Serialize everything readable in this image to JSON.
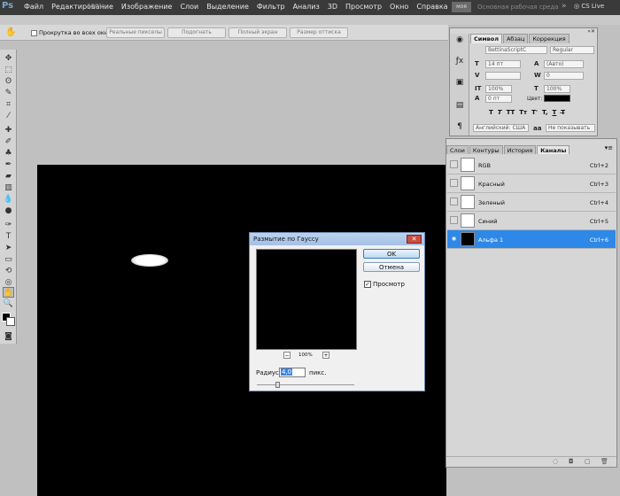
{
  "app": {
    "logo": "Ps",
    "workspace_button": "моя",
    "workspace_name": "Основная рабочая среда",
    "cs_live": "CS Live"
  },
  "menu": [
    "Файл",
    "Редактирование",
    "Изображение",
    "Слои",
    "Выделение",
    "Фильтр",
    "Анализ",
    "3D",
    "Просмотр",
    "Окно",
    "Справка"
  ],
  "zoom_readout": "100%",
  "options": {
    "scroll_all_label": "Прокрутка во всех окнах",
    "buttons": [
      "Реальные пикселы",
      "Подогнать",
      "Полный экран",
      "Размер оттиска"
    ]
  },
  "character_panel": {
    "tabs": [
      "Символ",
      "Абзац",
      "Коррекция"
    ],
    "font_family": "BettinaScriptC",
    "font_style": "Regular",
    "size": "14 пт",
    "leading": "(Авто)",
    "tracking": "0",
    "vscale": "100%",
    "hscale": "100%",
    "baseline": "0 пт",
    "color_label": "Цвет:",
    "glyph_row": [
      "T",
      "T",
      "TT",
      "Tт",
      "T'",
      "T,",
      "T",
      "T̶"
    ],
    "language": "Английский: США",
    "aa_label": "aa",
    "antialias": "Не показывать"
  },
  "channels_panel": {
    "tabs": [
      "Слои",
      "Контуры",
      "История",
      "Каналы"
    ],
    "rows": [
      {
        "name": "RGB",
        "shortcut": "Ctrl+2"
      },
      {
        "name": "Красный",
        "shortcut": "Ctrl+3"
      },
      {
        "name": "Зеленый",
        "shortcut": "Ctrl+4"
      },
      {
        "name": "Синий",
        "shortcut": "Ctrl+5"
      },
      {
        "name": "Альфа 1",
        "shortcut": "Ctrl+6"
      }
    ]
  },
  "dialog": {
    "title": "Размытие по Гауссу",
    "ok": "OK",
    "cancel": "Отмена",
    "preview_label": "Просмотр",
    "preview_checked": true,
    "zoom": "100%",
    "radius_label": "Радиус:",
    "radius_value": "4,0",
    "radius_unit": "пикс."
  }
}
